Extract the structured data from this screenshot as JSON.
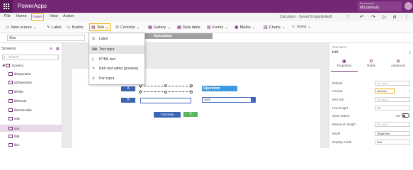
{
  "app": {
    "name": "PowerApps"
  },
  "environment": {
    "label": "Environment",
    "name": "MS (default)"
  },
  "menu": {
    "items": [
      "File",
      "Home",
      "Insert",
      "View",
      "Action"
    ],
    "active": "Insert"
  },
  "status": "Calculator - Saved (Unpublished)",
  "ribbon": {
    "new_screen": "New screen",
    "label": "Label",
    "button": "Button",
    "text": "Text",
    "controls": "Controls",
    "gallery": "Gallery",
    "data_table": "Data table",
    "forms": "Forms",
    "media": "Media",
    "charts": "Charts",
    "icons": "Icons"
  },
  "formula": {
    "property": "Size",
    "fx": "fx"
  },
  "screens_panel": {
    "title": "Screens",
    "search_placeholder": "Search",
    "items": [
      {
        "name": "Screen1"
      },
      {
        "name": "lblOperation"
      },
      {
        "name": "ddOperation"
      },
      {
        "name": "lblTitle"
      },
      {
        "name": "lblResult"
      },
      {
        "name": "btnCalculate"
      },
      {
        "name": "txtB"
      },
      {
        "name": "txtA"
      },
      {
        "name": "lblB"
      },
      {
        "name": "lblA"
      }
    ]
  },
  "insert_menu": {
    "items": [
      "Label",
      "Text input",
      "HTML text",
      "Rich text editor (preview)",
      "Pen input"
    ],
    "hover": "Text input"
  },
  "canvas": {
    "title": "Calculator",
    "label_a": "A",
    "label_b": "B",
    "operation_label": "Operation",
    "operation_value": "Sum",
    "calculate": "Calculate",
    "result": "0"
  },
  "properties": {
    "control_type": "TEXT INPUT",
    "control_name": "txtA",
    "tabs": [
      "Properties",
      "Rules",
      "Advanced"
    ],
    "rows": [
      {
        "label": "Default",
        "value": "No value"
      },
      {
        "label": "Format",
        "value": "Number"
      },
      {
        "label": "Hint text",
        "value": "No value"
      },
      {
        "label": "Line height",
        "value": "1.2"
      },
      {
        "label": "Clear button",
        "value": "Off"
      },
      {
        "label": "Maximum length",
        "value": "No value"
      },
      {
        "label": "Mode",
        "value": "Single line"
      },
      {
        "label": "Display mode",
        "value": "Edit"
      }
    ]
  },
  "colors": {
    "brand": "#742774",
    "accent": "#f2a900",
    "control_blue": "#3c64b4"
  }
}
